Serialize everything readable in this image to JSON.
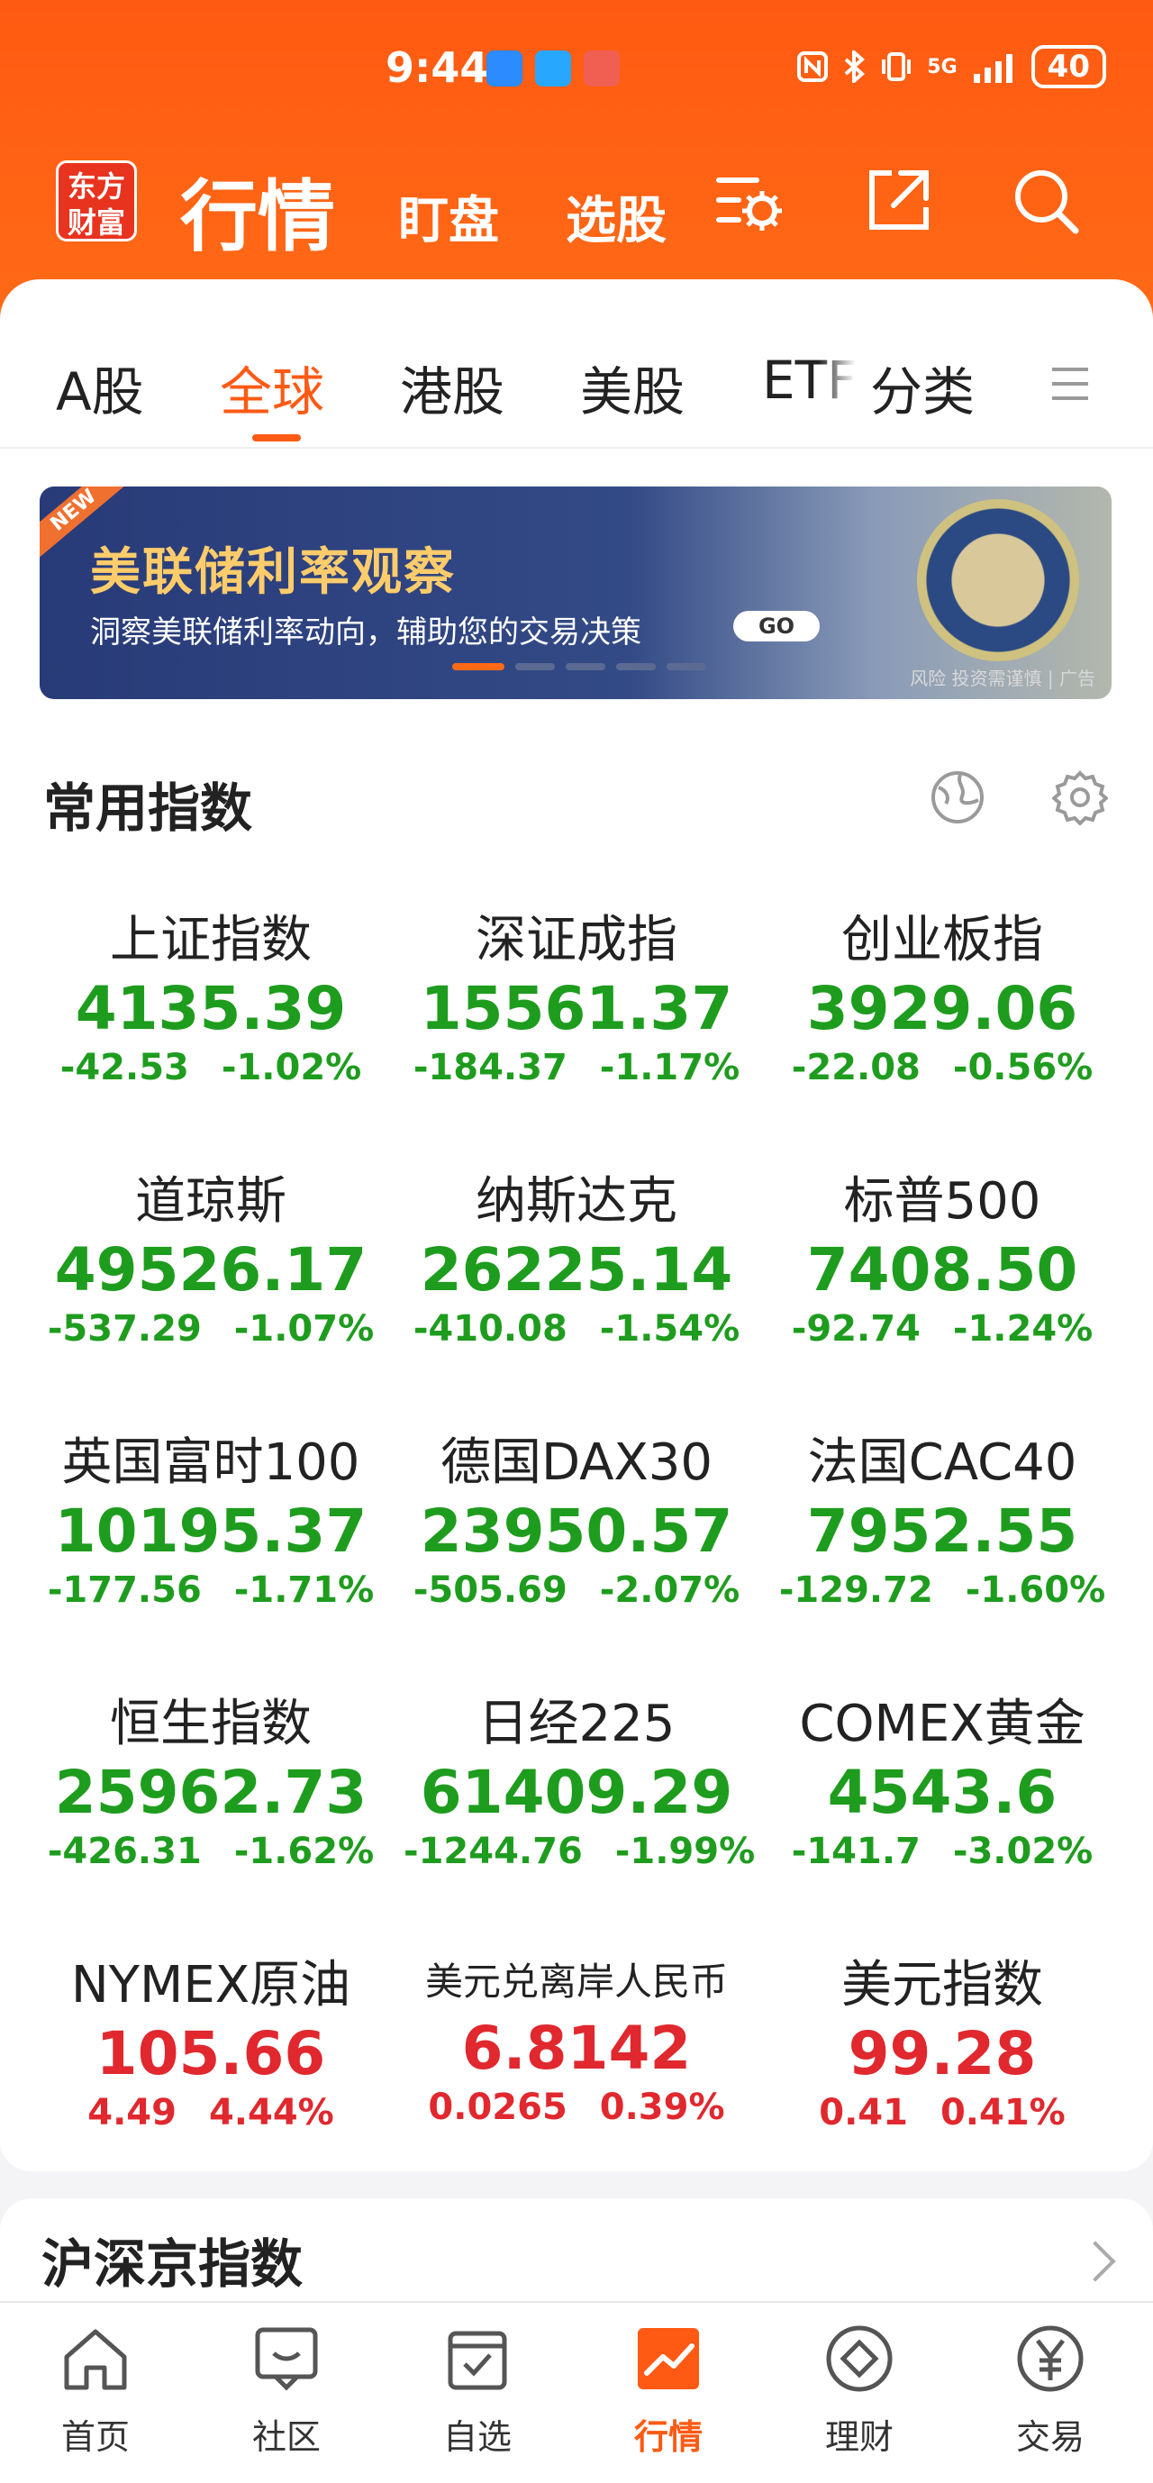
{
  "status": {
    "time": "9:44",
    "battery": "40",
    "net": "5G"
  },
  "header": {
    "logo_line1": "东方",
    "logo_line2": "财富",
    "title": "行情",
    "tabs": [
      "盯盘",
      "选股"
    ]
  },
  "market_tabs": [
    "A股",
    "全球",
    "港股",
    "美股",
    "ETF",
    "分类"
  ],
  "banner": {
    "new": "NEW",
    "title": "美联储利率观察",
    "subtitle": "洞察美联储利率动向，辅助您的交易决策",
    "go": "GO",
    "risk": "风险 投资需谨慎 | 广告"
  },
  "section1": {
    "title": "常用指数"
  },
  "indices": [
    {
      "name": "上证指数",
      "price": "4135.39",
      "change": "-42.53",
      "pct": "-1.02%",
      "color": "green"
    },
    {
      "name": "深证成指",
      "price": "15561.37",
      "change": "-184.37",
      "pct": "-1.17%",
      "color": "green"
    },
    {
      "name": "创业板指",
      "price": "3929.06",
      "change": "-22.08",
      "pct": "-0.56%",
      "color": "green"
    },
    {
      "name": "道琼斯",
      "price": "49526.17",
      "change": "-537.29",
      "pct": "-1.07%",
      "color": "green"
    },
    {
      "name": "纳斯达克",
      "price": "26225.14",
      "change": "-410.08",
      "pct": "-1.54%",
      "color": "green"
    },
    {
      "name": "标普500",
      "price": "7408.50",
      "change": "-92.74",
      "pct": "-1.24%",
      "color": "green"
    },
    {
      "name": "英国富时100",
      "price": "10195.37",
      "change": "-177.56",
      "pct": "-1.71%",
      "color": "green"
    },
    {
      "name": "德国DAX30",
      "price": "23950.57",
      "change": "-505.69",
      "pct": "-2.07%",
      "color": "green"
    },
    {
      "name": "法国CAC40",
      "price": "7952.55",
      "change": "-129.72",
      "pct": "-1.60%",
      "color": "green"
    },
    {
      "name": "恒生指数",
      "price": "25962.73",
      "change": "-426.31",
      "pct": "-1.62%",
      "color": "green"
    },
    {
      "name": "日经225",
      "price": "61409.29",
      "change": "-1244.76",
      "pct": "-1.99%",
      "color": "green"
    },
    {
      "name": "COMEX黄金",
      "price": "4543.6",
      "change": "-141.7",
      "pct": "-3.02%",
      "color": "green"
    },
    {
      "name": "NYMEX原油",
      "price": "105.66",
      "change": "4.49",
      "pct": "4.44%",
      "color": "red"
    },
    {
      "name": "美元兑离岸人民币",
      "price": "6.8142",
      "change": "0.0265",
      "pct": "0.39%",
      "color": "red"
    },
    {
      "name": "美元指数",
      "price": "99.28",
      "change": "0.41",
      "pct": "0.41%",
      "color": "red"
    }
  ],
  "section2": {
    "title": "沪深京指数"
  },
  "bottom_nav": [
    {
      "label": "首页",
      "icon": "home-icon"
    },
    {
      "label": "社区",
      "icon": "chat-icon"
    },
    {
      "label": "自选",
      "icon": "watchlist-icon"
    },
    {
      "label": "行情",
      "icon": "market-icon"
    },
    {
      "label": "理财",
      "icon": "finance-icon"
    },
    {
      "label": "交易",
      "icon": "yuan-icon"
    }
  ]
}
